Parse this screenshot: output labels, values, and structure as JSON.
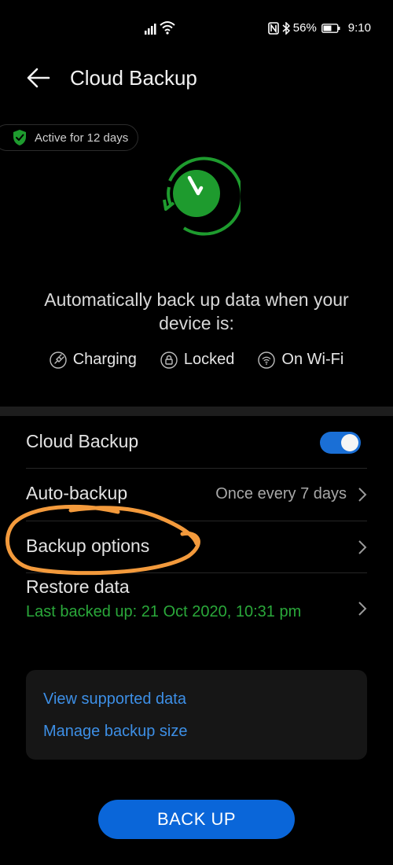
{
  "status_bar": {
    "battery": "56%",
    "time": "9:10",
    "icons": [
      "signal-icon",
      "wifi-icon",
      "nfc-icon",
      "bluetooth-icon",
      "battery-icon"
    ]
  },
  "header": {
    "title": "Cloud Backup",
    "back_icon": "back-arrow-icon"
  },
  "active_badge": {
    "text": "Active for 12 days",
    "icon": "shield-check-icon",
    "color": "#1e9b2e"
  },
  "hero": {
    "icon": "backup-clock-icon",
    "description": "Automatically back up data when your device is:",
    "conditions": [
      {
        "label": "Charging",
        "icon": "charging-icon"
      },
      {
        "label": "Locked",
        "icon": "lock-icon"
      },
      {
        "label": "On Wi-Fi",
        "icon": "wifi-icon"
      }
    ]
  },
  "settings": {
    "cloud_backup": {
      "label": "Cloud Backup",
      "toggle_on": true
    },
    "auto_backup": {
      "label": "Auto-backup",
      "value": "Once every 7 days"
    },
    "backup_options": {
      "label": "Backup options"
    },
    "restore_data": {
      "label": "Restore data",
      "subtitle": "Last backed up: 21 Oct 2020, 10:31 pm"
    }
  },
  "links": {
    "view_supported": "View supported data",
    "manage_size": "Manage backup size"
  },
  "actions": {
    "back_up_label": "BACK UP"
  },
  "colors": {
    "accent_blue": "#0a66d9",
    "link_blue": "#3d8fe6",
    "success_green": "#2aa83a",
    "annotation_orange": "#f39a3c"
  }
}
